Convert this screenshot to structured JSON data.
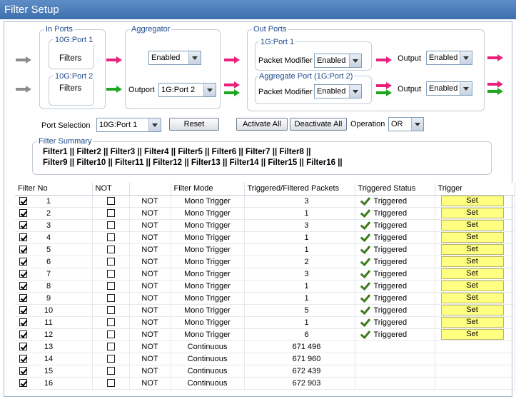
{
  "window": {
    "title": "Filter Setup"
  },
  "colors": {
    "pink_arrow": "#e8207a",
    "green_arrow": "#1fa51f",
    "gray_arrow": "#8c8c8c",
    "set_button": "#ffff82"
  },
  "in_ports": {
    "title": "In Ports",
    "port1_title": "10G:Port 1",
    "port1_label": "Filters",
    "port2_title": "10G:Port 2",
    "port2_label": "Filters"
  },
  "aggregator": {
    "title": "Aggregator",
    "state": "Enabled",
    "outport_label": "Outport",
    "outport_value": "1G:Port 2"
  },
  "out_ports": {
    "title": "Out Ports",
    "port1_title": "1G:Port 1",
    "port1_modifier_label": "Packet Modifier",
    "port1_modifier_value": "Enabled",
    "port1_output_label": "Output",
    "port1_output_value": "Enabled",
    "aggregate_title": "Aggregate Port (1G:Port 2)",
    "aggregate_modifier_label": "Packet Modifier",
    "aggregate_modifier_value": "Enabled",
    "aggregate_output_label": "Output",
    "aggregate_output_value": "Enabled"
  },
  "controls": {
    "port_selection_label": "Port Selection",
    "port_selection_value": "10G:Port 1",
    "reset": "Reset",
    "activate_all": "Activate All",
    "deactivate_all": "Deactivate All",
    "operation_label": "Operation",
    "operation_value": "OR"
  },
  "summary": {
    "title": "Filter Summary",
    "line1": "Filter1 || Filter2 || Filter3 || Filter4 || Filter5 || Filter6 || Filter7 || Filter8 ||",
    "line2": "Filter9 || Filter10 || Filter11 || Filter12 || Filter13 || Filter14 || Filter15 || Filter16 ||"
  },
  "table": {
    "headers": [
      "Filter No",
      "NOT",
      "",
      "Filter Mode",
      "Triggered/Filtered Packets",
      "Triggered Status",
      "Trigger"
    ],
    "rows": [
      {
        "no": "1",
        "enabled": true,
        "not_checked": false,
        "not_label": "NOT",
        "mode": "Mono Trigger",
        "packets": "3",
        "status": "Triggered",
        "trigger": "Set"
      },
      {
        "no": "2",
        "enabled": true,
        "not_checked": false,
        "not_label": "NOT",
        "mode": "Mono Trigger",
        "packets": "1",
        "status": "Triggered",
        "trigger": "Set"
      },
      {
        "no": "3",
        "enabled": true,
        "not_checked": false,
        "not_label": "NOT",
        "mode": "Mono Trigger",
        "packets": "3",
        "status": "Triggered",
        "trigger": "Set"
      },
      {
        "no": "4",
        "enabled": true,
        "not_checked": false,
        "not_label": "NOT",
        "mode": "Mono Trigger",
        "packets": "1",
        "status": "Triggered",
        "trigger": "Set"
      },
      {
        "no": "5",
        "enabled": true,
        "not_checked": false,
        "not_label": "NOT",
        "mode": "Mono Trigger",
        "packets": "1",
        "status": "Triggered",
        "trigger": "Set"
      },
      {
        "no": "6",
        "enabled": true,
        "not_checked": false,
        "not_label": "NOT",
        "mode": "Mono Trigger",
        "packets": "2",
        "status": "Triggered",
        "trigger": "Set"
      },
      {
        "no": "7",
        "enabled": true,
        "not_checked": false,
        "not_label": "NOT",
        "mode": "Mono Trigger",
        "packets": "3",
        "status": "Triggered",
        "trigger": "Set"
      },
      {
        "no": "8",
        "enabled": true,
        "not_checked": false,
        "not_label": "NOT",
        "mode": "Mono Trigger",
        "packets": "1",
        "status": "Triggered",
        "trigger": "Set"
      },
      {
        "no": "9",
        "enabled": true,
        "not_checked": false,
        "not_label": "NOT",
        "mode": "Mono Trigger",
        "packets": "1",
        "status": "Triggered",
        "trigger": "Set"
      },
      {
        "no": "10",
        "enabled": true,
        "not_checked": false,
        "not_label": "NOT",
        "mode": "Mono Trigger",
        "packets": "5",
        "status": "Triggered",
        "trigger": "Set"
      },
      {
        "no": "11",
        "enabled": true,
        "not_checked": false,
        "not_label": "NOT",
        "mode": "Mono Trigger",
        "packets": "1",
        "status": "Triggered",
        "trigger": "Set"
      },
      {
        "no": "12",
        "enabled": true,
        "not_checked": false,
        "not_label": "NOT",
        "mode": "Mono Trigger",
        "packets": "6",
        "status": "Triggered",
        "trigger": "Set"
      },
      {
        "no": "13",
        "enabled": true,
        "not_checked": false,
        "not_label": "NOT",
        "mode": "Continuous",
        "packets": "671 496",
        "status": "",
        "trigger": ""
      },
      {
        "no": "14",
        "enabled": true,
        "not_checked": false,
        "not_label": "NOT",
        "mode": "Continuous",
        "packets": "671 960",
        "status": "",
        "trigger": ""
      },
      {
        "no": "15",
        "enabled": true,
        "not_checked": false,
        "not_label": "NOT",
        "mode": "Continuous",
        "packets": "672 439",
        "status": "",
        "trigger": ""
      },
      {
        "no": "16",
        "enabled": true,
        "not_checked": false,
        "not_label": "NOT",
        "mode": "Continuous",
        "packets": "672 903",
        "status": "",
        "trigger": ""
      }
    ]
  }
}
